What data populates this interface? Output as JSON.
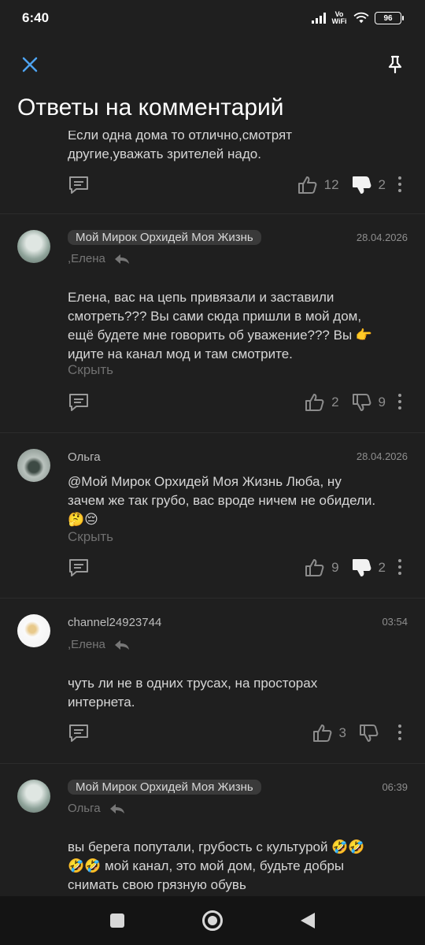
{
  "status": {
    "time": "6:40",
    "network": "Vo WiFi",
    "battery": "96"
  },
  "header": {
    "title": "Ответы на комментарий"
  },
  "comments": [
    {
      "text_lines": [
        "Если одна дома то отлично,смотрят",
        "другие,уважать зрителей надо."
      ],
      "likes": "12",
      "dislikes": "2"
    },
    {
      "author": "Мой Мирок Орхидей Моя Жизнь",
      "date": "28.04.2026",
      "reply_to": ",Елена",
      "text_lines": [
        "Елена, вас на цепь привязали и заставили",
        "смотреть??? Вы сами сюда пришли в мой дом,",
        "ещё будете мне говорить об уважение??? Вы 👉",
        "идите на канал мод и там смотрите."
      ],
      "hide": "Скрыть",
      "likes": "2",
      "dislikes": "9"
    },
    {
      "author": "Ольга",
      "date": "28.04.2026",
      "text_lines": [
        "@Мой Мирок Орхидей Моя Жизнь Люба, ну",
        "зачем же так грубо, вас вроде ничем не обидели.",
        "🤔😔"
      ],
      "hide": "Скрыть",
      "likes": "9",
      "dislikes": "2"
    },
    {
      "author": "channel24923744",
      "date": "03:54",
      "reply_to": ",Елена",
      "text_lines": [
        "чуть ли не в одних трусах, на просторах",
        "интернета."
      ],
      "likes": "3",
      "dislikes": ""
    },
    {
      "author": "Мой Мирок Орхидей Моя Жизнь",
      "date": "06:39",
      "reply_to": "Ольга",
      "text_lines": [
        "вы берега попутали, грубость с культурой 🤣🤣",
        "🤣🤣 мой канал, это мой дом, будьте добры",
        "снимать свою грязную обувь"
      ]
    }
  ],
  "icons": {
    "close": "close-icon",
    "pin": "pin-icon",
    "reply": "reply-icon",
    "like": "thumb-up-icon",
    "dislike": "thumb-down-icon",
    "more": "more-vertical-icon",
    "nav_recents": "square-icon",
    "nav_home": "home-icon",
    "nav_back": "back-icon"
  },
  "colors": {
    "background": "#1f1f1f",
    "accent": "#4ea3f0",
    "pill": "#3a3a3a"
  }
}
